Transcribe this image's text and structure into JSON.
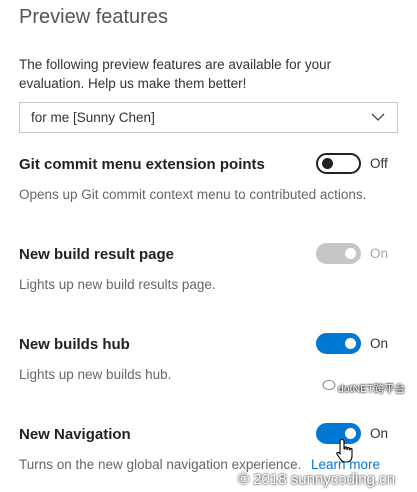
{
  "page": {
    "title": "Preview features",
    "intro": "The following preview features are available for your evaluation. Help us make them better!"
  },
  "scope_dropdown": {
    "selected": "for me [Sunny Chen]"
  },
  "features": [
    {
      "title": "Git commit menu extension points",
      "description": "Opens up Git commit context menu to contributed actions.",
      "state": "Off",
      "enabled": true,
      "checked": false
    },
    {
      "title": "New build result page",
      "description": "Lights up new build results page.",
      "state": "On",
      "enabled": false,
      "checked": true
    },
    {
      "title": "New builds hub",
      "description": "Lights up new builds hub.",
      "state": "On",
      "enabled": true,
      "checked": true
    },
    {
      "title": "New Navigation",
      "description": "Turns on the new global navigation experience.",
      "state": "On",
      "enabled": true,
      "checked": true,
      "link": "Learn more"
    }
  ],
  "watermarks": {
    "top": "dotNET跨平台",
    "bottom": "© 2018 sunnycoding.cn"
  },
  "colors": {
    "accent": "#0078d4",
    "disabled": "#c6c6c6"
  },
  "icons": {
    "dropdown": "chevron-down-icon",
    "cursor": "hand-pointer-icon"
  }
}
